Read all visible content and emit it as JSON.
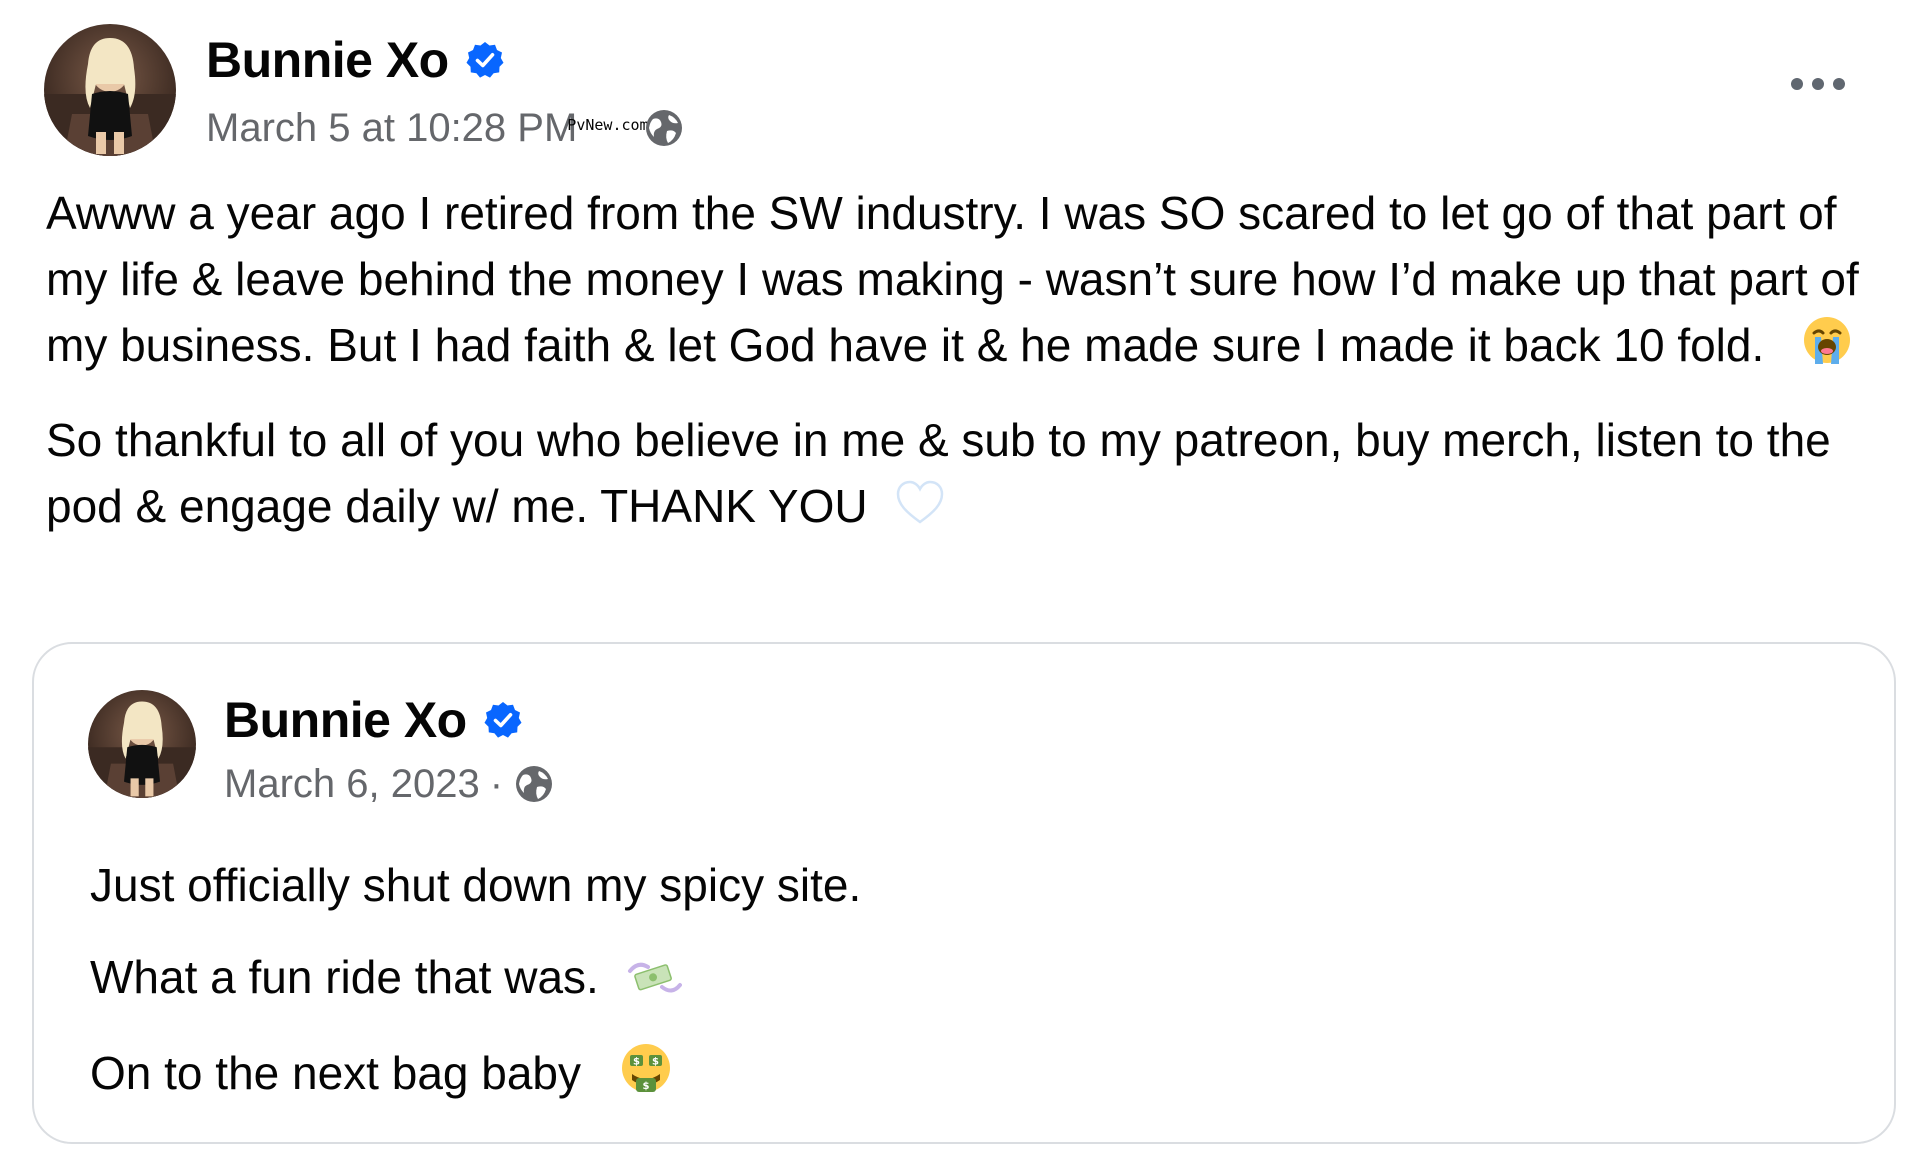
{
  "post": {
    "author": "Bunnie Xo",
    "verified_icon": "verified-badge-icon",
    "timestamp": "March 5 at 10:28 PM",
    "watermark": "PvNew.com",
    "privacy_icon": "globe-icon",
    "more_icon": "more-options-icon",
    "paragraphs": [
      "Awww a year ago I retired from the SW industry. I was SO scared to let go of that part of my life & leave behind the money I was making - wasn’t sure how I’d make up that part of my business. But I had faith & let God have it & he made sure I made it back 10 fold.",
      "So thankful to all of you who believe in me & sub to my patreon, buy merch, listen to the pod & engage daily w/ me. THANK YOU"
    ],
    "paragraph_emojis": [
      "loudly-crying-face-emoji",
      "white-heart-emoji"
    ]
  },
  "shared_post": {
    "author": "Bunnie Xo",
    "verified_icon": "verified-badge-icon",
    "timestamp": "March 6, 2023",
    "separator": "·",
    "privacy_icon": "globe-icon",
    "lines": [
      "Just officially shut down my spicy site.",
      "What a fun ride that was.",
      "On to the next bag baby"
    ],
    "line_emojis": [
      "",
      "flying-money-emoji",
      "money-mouth-face-emoji"
    ]
  },
  "colors": {
    "text_primary": "#050505",
    "text_secondary": "#65676b",
    "verified_blue": "#0866ff",
    "card_border": "#dadde1"
  }
}
